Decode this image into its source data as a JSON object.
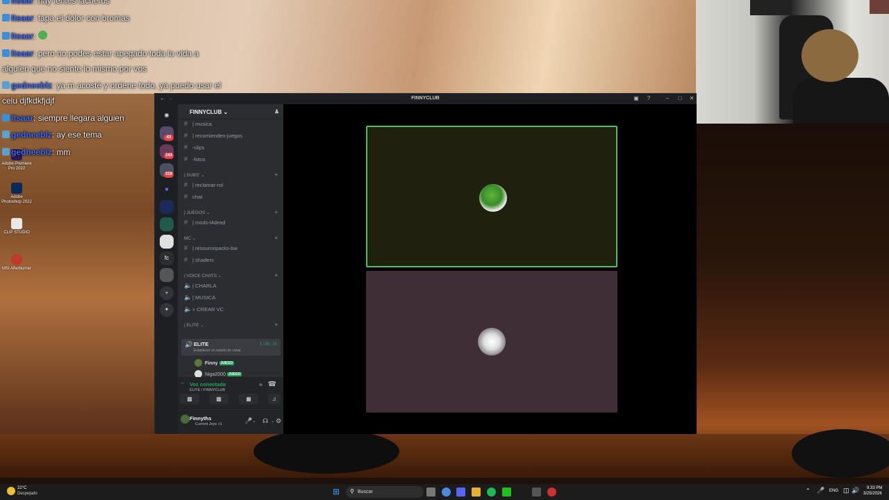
{
  "stream_chat": [
    {
      "user": "Itsaar",
      "text": ": hay lentes lacheros"
    },
    {
      "user": "Itsaar",
      "text": ": tapa el dolor con bromas"
    },
    {
      "user": "Itsaar",
      "text": ":"
    },
    {
      "user": "Itsaar",
      "text": ": pero no podes estar apegado toda la vida a"
    },
    {
      "user": "",
      "text": "alguien que no siente lo mismo por vos"
    },
    {
      "user": "gedneeblz",
      "text": ": ya m acosté y ordene todo, ya puedo usar el"
    },
    {
      "user": "",
      "text": "celu djfkdkfjdjf"
    },
    {
      "user": "Itsaar",
      "text": ": siempre llegara alguien"
    },
    {
      "user": "gedneeblz",
      "text": ": ay ese tema"
    },
    {
      "user": "gedneeblz",
      "text": ": mm"
    }
  ],
  "desktop_icons": [
    {
      "label": "Adobe Premiere Pro 2022",
      "color": "#2a1a5a"
    },
    {
      "label": "Adobe Photoshop 2022",
      "color": "#0a2a5a"
    },
    {
      "label": "CLIP STUDIO",
      "color": "#e8e8e8"
    },
    {
      "label": "MSI Afterburner",
      "color": "#c0392b"
    }
  ],
  "discord": {
    "window_title": "FINNYCLUB",
    "server_name": "FINNYCLUB",
    "server_badges": [
      "43",
      "243",
      "319"
    ],
    "rail_fc": "fc",
    "channels": [
      {
        "name": "| musica",
        "type": "text"
      },
      {
        "name": "| recomienden-juegos",
        "type": "text"
      },
      {
        "name": "-clips",
        "type": "text"
      },
      {
        "name": "-fotos",
        "type": "text"
      }
    ],
    "categories": {
      "subs": "| SUBS'",
      "juegos": "| JUEGOS",
      "mc": "MC",
      "voice": "| VOICE CHATS",
      "elite": "| ELITE"
    },
    "subs_channels": [
      "| reclamar-rol",
      "chat"
    ],
    "juegos_channels": [
      "| mods-l4dead"
    ],
    "mc_channels": [
      "| resourcepacks-bw",
      "| shaders"
    ],
    "voice_channels": [
      "| CHARLA",
      "| MUSICA",
      "» CREAR VC"
    ],
    "active_voice": {
      "name": "ELITE",
      "timer": "1:36:35",
      "status": "Establecer un estado de canal"
    },
    "members": [
      {
        "name": "Finny",
        "tag": "JUEGO"
      },
      {
        "name": "Niga2000",
        "tag": "JUEGO"
      }
    ],
    "voice_panel": {
      "status": "Voz conectada",
      "location": "ELITE / FINNYCLUB"
    },
    "user": {
      "name": "Finnyths",
      "status": "Current Joys +1"
    }
  },
  "taskbar": {
    "weather_temp": "22°C",
    "weather_desc": "Despejado",
    "search_placeholder": "Buscar",
    "lang": "ENG",
    "time": "9:33 PM",
    "date": "3/25/2026"
  },
  "colors": {
    "speaking_border": "#4cc15e",
    "discord_green": "#23a55a",
    "chat_name": "#3b6cff"
  }
}
